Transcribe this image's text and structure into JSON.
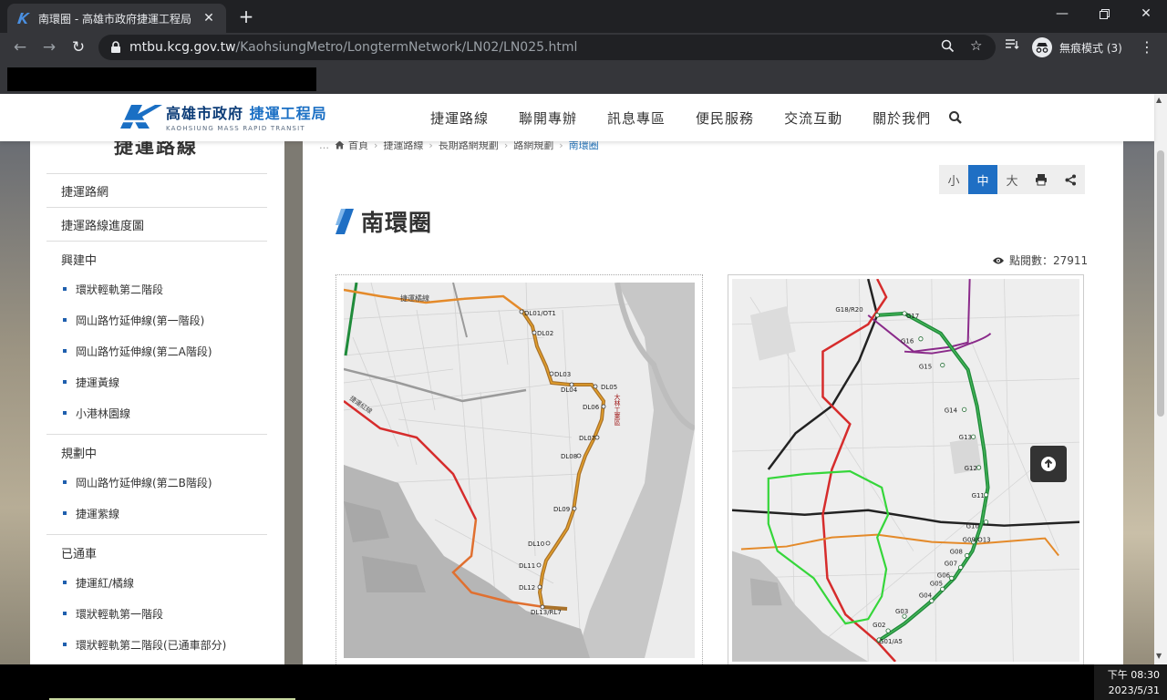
{
  "browser": {
    "tab_title": "南環圈 - 高雄市政府捷運工程局",
    "url_domain": "mtbu.kcg.gov.tw",
    "url_path": "/KaohsiungMetro/LongtermNetwork/LN02/LN025.html",
    "incognito_label": "無痕模式 (3)"
  },
  "header": {
    "logo_zh_1": "高雄市政府",
    "logo_zh_2": "捷運工程局",
    "logo_en": "KAOHSIUNG MASS RAPID TRANSIT",
    "nav": [
      "捷運路線",
      "聯開專辦",
      "訊息專區",
      "便民服務",
      "交流互動",
      "關於我們"
    ]
  },
  "sidebar": {
    "title": "捷運路線",
    "links": [
      "捷運路網",
      "捷運路線進度圖"
    ],
    "groups": [
      {
        "label": "興建中",
        "items": [
          "環狀輕軌第二階段",
          "岡山路竹延伸線(第一階段)",
          "岡山路竹延伸線(第二A階段)",
          "捷運黃線",
          "小港林園線"
        ]
      },
      {
        "label": "規劃中",
        "items": [
          "岡山路竹延伸線(第二B階段)",
          "捷運紫線"
        ]
      },
      {
        "label": "已通車",
        "items": [
          "捷運紅/橘線",
          "環狀輕軌第一階段",
          "環狀輕軌第二階段(已通車部分)"
        ]
      }
    ]
  },
  "breadcrumb": [
    "首頁",
    "捷運路線",
    "長期路網規劃",
    "路網規劃",
    "南環圈"
  ],
  "fontsize": {
    "small": "小",
    "medium": "中",
    "large": "大"
  },
  "page": {
    "title": "南環圈",
    "views_label": "點閱數：27911"
  },
  "map1": {
    "stations": [
      "DL01/OT1",
      "DL02",
      "DL03",
      "DL04",
      "DL05",
      "DL06",
      "DL07",
      "DL08",
      "DL09",
      "DL10",
      "DL11",
      "DL12",
      "DL13/RL7"
    ],
    "label_top": "捷運橘線",
    "label_left": "捷運紅線",
    "label_right": "大林工業區"
  },
  "map2": {
    "stations": [
      "G18/R20",
      "G17",
      "G16",
      "G15",
      "G14",
      "G13",
      "G12",
      "G11",
      "G10",
      "G09/O13",
      "G08",
      "G07",
      "G06",
      "G05",
      "G04",
      "G03",
      "G02",
      "G01/A5"
    ]
  },
  "taskbar": {
    "time": "下午 08:30",
    "date": "2023/5/31"
  },
  "colors": {
    "brand": "#1f6fc4",
    "orange_line": "#e48a2a",
    "red_line": "#d62c2c",
    "green_line": "#1f8b3a",
    "light_green": "#35d63a",
    "purple_line": "#8a2a8a"
  }
}
